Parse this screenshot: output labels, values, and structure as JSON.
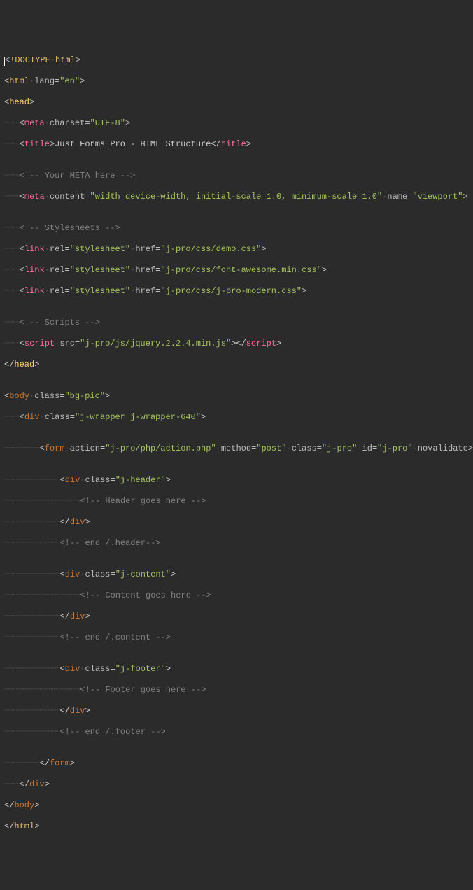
{
  "lines": {
    "l1_doctype": "!DOCTYPE",
    "l1_html": "html",
    "l2_tag": "html",
    "l2_attr": "lang",
    "l2_val": "\"en\"",
    "l3_tag": "head",
    "l4_tag": "meta",
    "l4_attr": "charset",
    "l4_val": "\"UTF-8\"",
    "l5_tag": "title",
    "l5_text": "Just Forms Pro - HTML Structure",
    "l5_close": "title",
    "l7_comment": "<!-- Your META here -->",
    "l8_tag": "meta",
    "l8_attr1": "content",
    "l8_val1": "\"width=device-width, initial-scale=1.0, minimum-scale=1.0\"",
    "l8_attr2": "name",
    "l8_val2": "\"viewport\"",
    "l10_comment": "<!-- Stylesheets -->",
    "l11_tag": "link",
    "l11_attr1": "rel",
    "l11_val1": "\"stylesheet\"",
    "l11_attr2": "href",
    "l11_val2": "\"j-pro/css/demo.css\"",
    "l12_tag": "link",
    "l12_attr1": "rel",
    "l12_val1": "\"stylesheet\"",
    "l12_attr2": "href",
    "l12_val2": "\"j-pro/css/font-awesome.min.css\"",
    "l13_tag": "link",
    "l13_attr1": "rel",
    "l13_val1": "\"stylesheet\"",
    "l13_attr2": "href",
    "l13_val2": "\"j-pro/css/j-pro-modern.css\"",
    "l15_comment": "<!-- Scripts -->",
    "l16_tag": "script",
    "l16_attr": "src",
    "l16_val": "\"j-pro/js/jquery.2.2.4.min.js\"",
    "l16_close": "script",
    "l17_tag": "head",
    "l19_tag": "body",
    "l19_attr": "class",
    "l19_val": "\"bg-pic\"",
    "l20_tag": "div",
    "l20_attr": "class",
    "l20_val": "\"j-wrapper j-wrapper-640\"",
    "l22_tag": "form",
    "l22_attr1": "action",
    "l22_val1": "\"j-pro/php/action.php\"",
    "l22_attr2": "method",
    "l22_val2": "\"post\"",
    "l22_attr3": "class",
    "l22_val3": "\"j-pro\"",
    "l22_attr4": "id",
    "l22_val4": "\"j-pro\"",
    "l22_attr5": "novalidate",
    "l24_tag": "div",
    "l24_attr": "class",
    "l24_val": "\"j-header\"",
    "l25_comment": "<!-- Header goes here -->",
    "l26_tag": "div",
    "l27_comment": "<!-- end /.header-->",
    "l29_tag": "div",
    "l29_attr": "class",
    "l29_val": "\"j-content\"",
    "l30_comment": "<!-- Content goes here -->",
    "l31_tag": "div",
    "l32_comment": "<!-- end /.content -->",
    "l34_tag": "div",
    "l34_attr": "class",
    "l34_val": "\"j-footer\"",
    "l35_comment": "<!-- Footer goes here -->",
    "l36_tag": "div",
    "l37_comment": "<!-- end /.footer -->",
    "l39_tag": "form",
    "l40_tag": "div",
    "l41_tag": "body",
    "l42_tag": "html"
  },
  "guides": {
    "g1": "┈┈┈",
    "g2": "┈┈┈┈┈┈┈",
    "g3": "┈┈┈┈┈┈┈┈┈┈┈",
    "g4": "┈┈┈┈┈┈┈┈┈┈┈┈┈┈┈"
  }
}
